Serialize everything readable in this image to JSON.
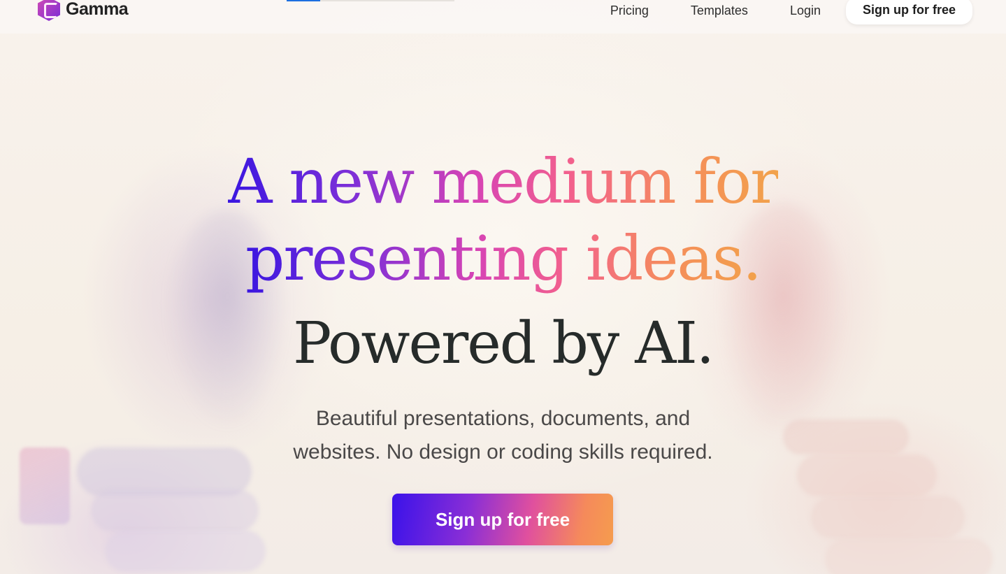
{
  "header": {
    "brand": "Gamma",
    "nav": {
      "pricing": "Pricing",
      "templates": "Templates",
      "login": "Login",
      "signup": "Sign up for free"
    }
  },
  "hero": {
    "line1": "A new medium for",
    "line2": "presenting ideas.",
    "line3": "Powered by AI.",
    "subtitle_line1": "Beautiful presentations, documents, and",
    "subtitle_line2": "websites. No design or coding skills required.",
    "cta": "Sign up for free"
  },
  "icons": {
    "logo": "gamma-logo-icon"
  },
  "colors": {
    "gradient_start": "#3a16e0",
    "gradient_mid": "#d744b4",
    "gradient_end": "#f2a24a",
    "heading_dark": "#262b2a",
    "link_blue": "#1d6fe0"
  }
}
